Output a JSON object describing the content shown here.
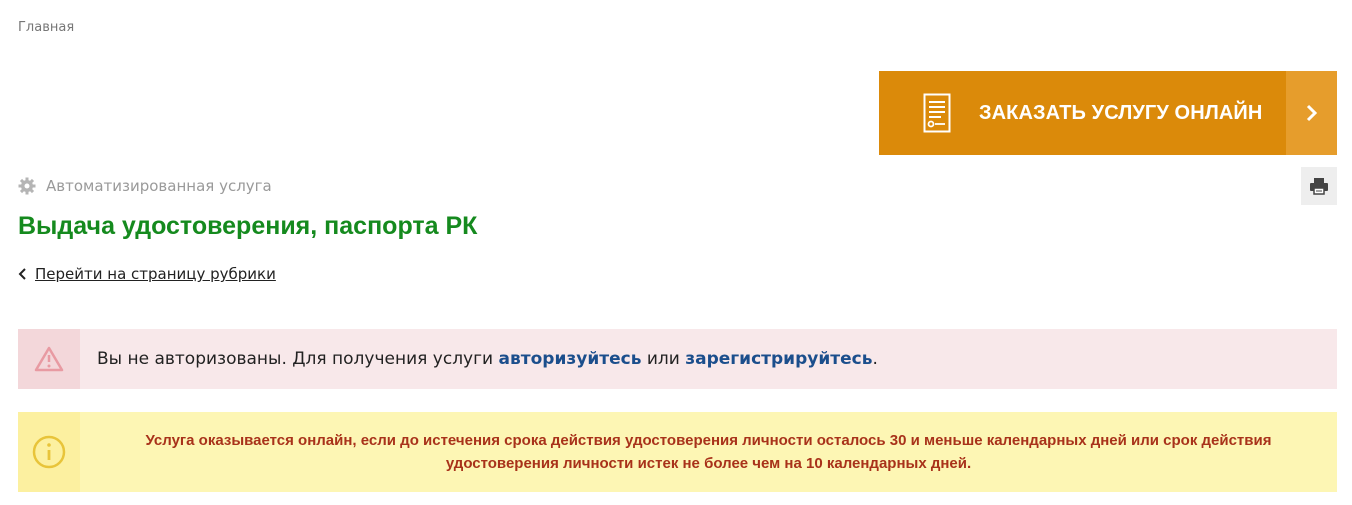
{
  "breadcrumb": {
    "home": "Главная"
  },
  "order_button": {
    "label": "ЗАКАЗАТЬ УСЛУГУ ОНЛАЙН",
    "icon": "document-icon",
    "arrow_icon": "chevron-right-icon"
  },
  "service": {
    "type_label": "Автоматизированная услуга",
    "type_icon": "gear-icon"
  },
  "page": {
    "title": "Выдача удостоверения, паспорта РК",
    "back_link": "Перейти на страницу рубрики"
  },
  "print": {
    "icon": "printer-icon"
  },
  "auth_alert": {
    "text_before": "Вы не авторизованы. Для получения услуги",
    "login_link": "авторизуйтесь",
    "or": "или",
    "register_link": "зарегистрируйтесь",
    "end": "."
  },
  "info_alert": {
    "line1": "Услуга оказывается онлайн, если до истечения срока действия удостоверения личности осталось 30 и меньше календарных дней или срок действия",
    "line2": "удостоверения личности истек не более чем на 10 календарных дней."
  },
  "colors": {
    "accent_orange": "#db8a0a",
    "title_green": "#158a1e",
    "link_blue": "#1b4e8c",
    "warning_red": "#a8321a"
  }
}
